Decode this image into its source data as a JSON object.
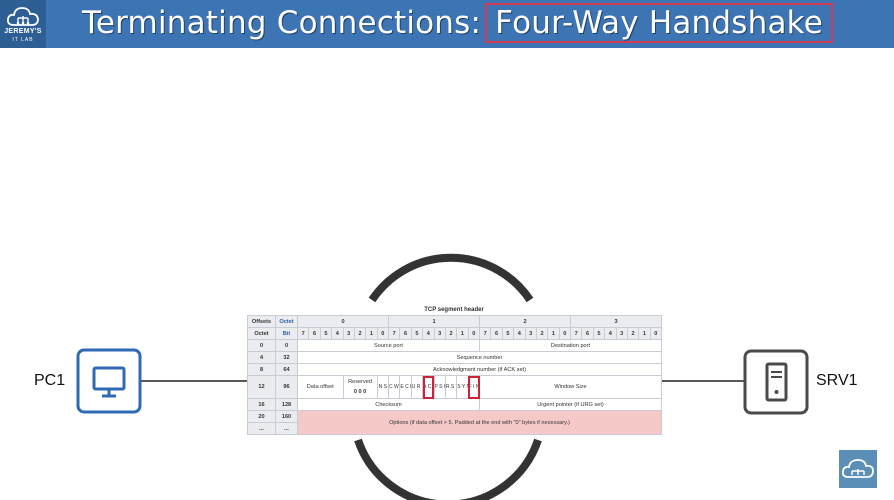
{
  "header": {
    "title_prefix": "Terminating Connections:",
    "title_highlight": "Four-Way Handshake",
    "logo_line1": "JEREMY'S",
    "logo_line2": "IT LAB",
    "bg_color": "#3d74b3",
    "highlight_color": "#d23a55"
  },
  "nodes": {
    "left_label": "PC1",
    "right_label": "SRV1"
  },
  "tcp_header": {
    "caption": "TCP segment header",
    "offsets_label": "Offsets",
    "octet_label": "Octet",
    "octet_row_label": "Octet",
    "bit_label": "Bit",
    "octet_numbers": [
      "0",
      "1",
      "2",
      "3"
    ],
    "bit_numbers": [
      "7",
      "6",
      "5",
      "4",
      "3",
      "2",
      "1",
      "0",
      "7",
      "6",
      "5",
      "4",
      "3",
      "2",
      "1",
      "0",
      "7",
      "6",
      "5",
      "4",
      "3",
      "2",
      "1",
      "0",
      "7",
      "6",
      "5",
      "4",
      "3",
      "2",
      "1",
      "0"
    ],
    "rows": [
      {
        "octet": "0",
        "bit": "0"
      },
      {
        "octet": "4",
        "bit": "32"
      },
      {
        "octet": "8",
        "bit": "64"
      },
      {
        "octet": "12",
        "bit": "96"
      },
      {
        "octet": "16",
        "bit": "128"
      },
      {
        "octet": "20",
        "bit": "160"
      },
      {
        "octet": "...",
        "bit": "..."
      }
    ],
    "source_port": "Source port",
    "destination_port": "Destination port",
    "sequence_number": "Sequence number",
    "ack_number": "Acknowledgment number (if ACK set)",
    "data_offset": "Data offset",
    "reserved": "Reserved",
    "reserved_bits": "0 0 0",
    "flags": [
      {
        "name": "ns",
        "text": "N S",
        "highlight": false
      },
      {
        "name": "cwr",
        "text": "C W R",
        "highlight": false
      },
      {
        "name": "ece",
        "text": "E C E",
        "highlight": false
      },
      {
        "name": "urg",
        "text": "U R G",
        "highlight": false
      },
      {
        "name": "ack",
        "text": "A C K",
        "highlight": true
      },
      {
        "name": "psh",
        "text": "P S H",
        "highlight": false
      },
      {
        "name": "rst",
        "text": "R S T",
        "highlight": false
      },
      {
        "name": "syn",
        "text": "S Y N",
        "highlight": false
      },
      {
        "name": "fin",
        "text": "F I N",
        "highlight": true
      }
    ],
    "window_size": "Window Size",
    "checksum": "Checksum",
    "urgent_pointer": "Urgent pointer (if URG set)",
    "options": "Options (if data offset > 5. Padded at the end with \"0\" bytes if necessary.)",
    "ellipsis": "..."
  }
}
